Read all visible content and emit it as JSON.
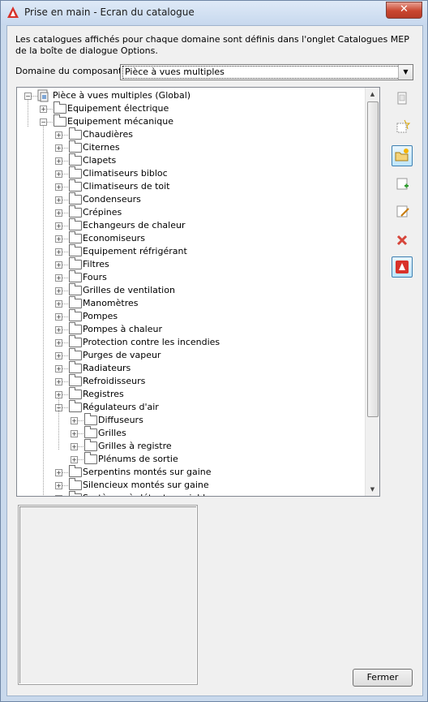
{
  "window": {
    "title": "Prise en main - Ecran du catalogue",
    "close_glyph": "✕"
  },
  "description": "Les catalogues affichés pour chaque domaine sont définis dans l'onglet Catalogues MEP de la boîte de dialogue Options.",
  "domain": {
    "label": "Domaine du composant:",
    "selected": "Pièce à vues multiples"
  },
  "tree": {
    "root": "Pièce à vues multiples (Global)",
    "level1": [
      "Equipement électrique",
      "Equipement mécanique"
    ],
    "mech_children": [
      "Chaudières",
      "Citernes",
      "Clapets",
      "Climatiseurs bibloc",
      "Climatiseurs de toit",
      "Condenseurs",
      "Crépines",
      "Echangeurs de chaleur",
      "Economiseurs",
      "Equipement réfrigérant",
      "Filtres",
      "Fours",
      "Grilles de ventilation",
      "Manomètres",
      "Pompes",
      "Pompes à chaleur",
      "Protection contre les incendies",
      "Purges de vapeur",
      "Radiateurs",
      "Refroidisseurs",
      "Registres",
      "Régulateurs d'air"
    ],
    "regulateurs_children": [
      "Diffuseurs",
      "Grilles",
      "Grilles à registre",
      "Plénums de sortie"
    ],
    "after_regulateurs": [
      "Serpentins montés sur gaine",
      "Silencieux montés sur gaine",
      "Systèmes à détente variable"
    ]
  },
  "toolbar": [
    "new-catalog-icon",
    "new-chapter-icon",
    "open-catalog-icon",
    "add-content-icon",
    "edit-content-icon",
    "delete-icon",
    "autocad-catalog-icon"
  ],
  "buttons": {
    "close": "Fermer"
  },
  "colors": {
    "accent": "#3c7fb1",
    "close_red": "#c9462f",
    "delete_red": "#d6453a"
  }
}
